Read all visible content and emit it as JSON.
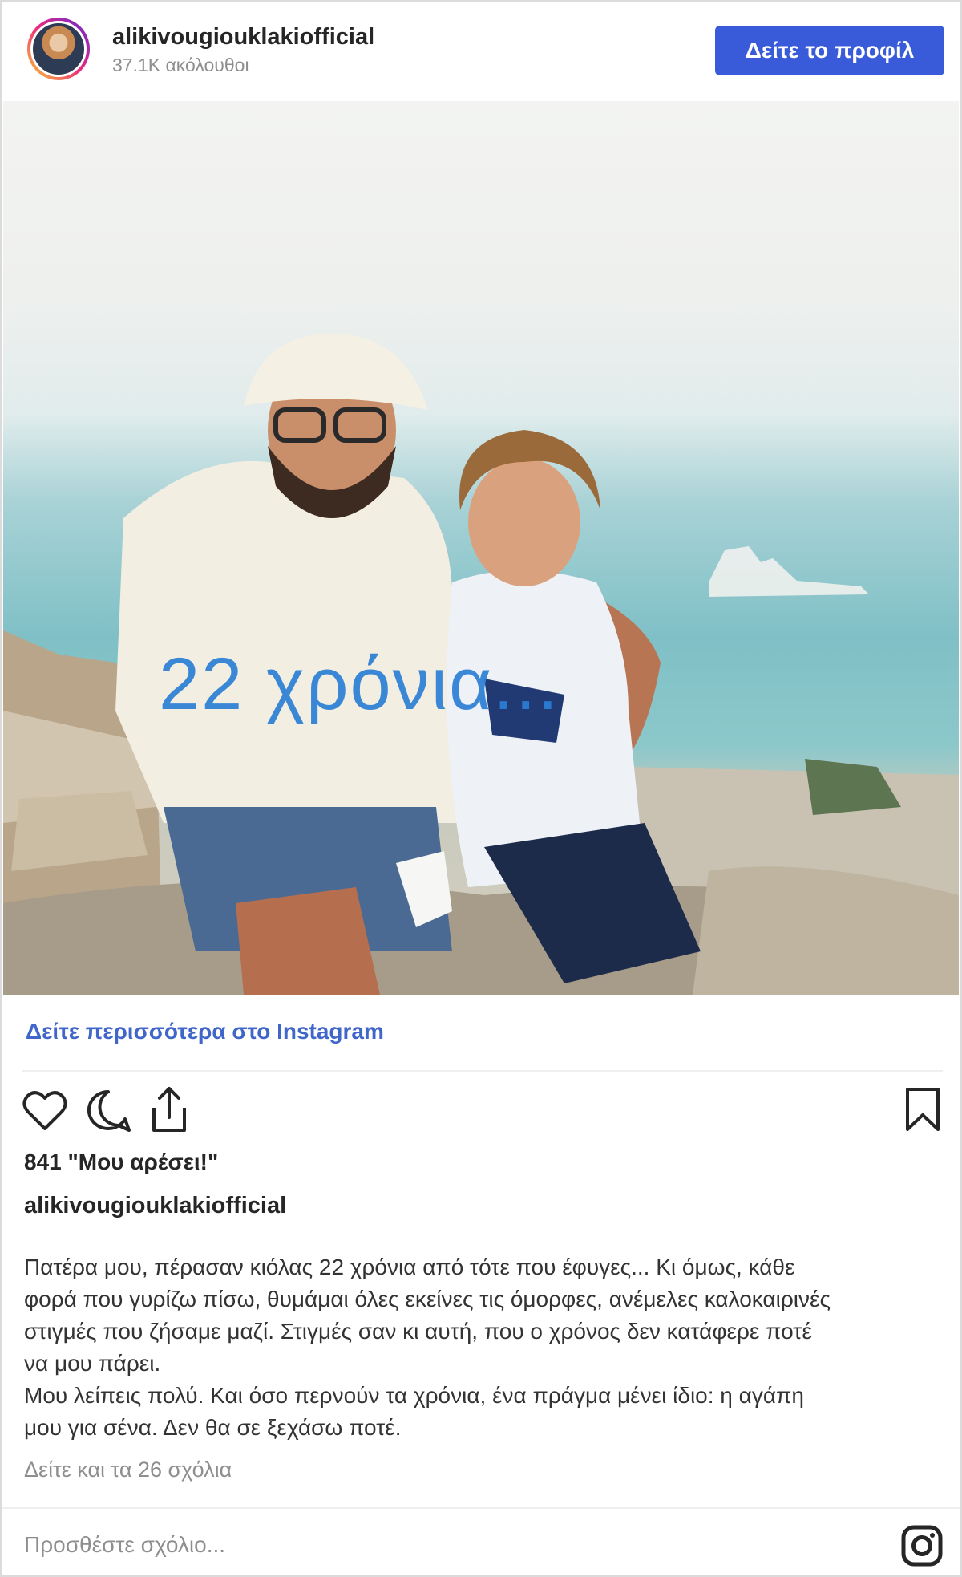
{
  "header": {
    "username": "alikivougiouklakiofficial",
    "followers": "37.1K ακόλουθοι",
    "profile_button": "Δείτε το προφίλ"
  },
  "photo": {
    "overlay_text": "22 χρόνια..."
  },
  "more_link": "Δείτε περισσότερα στο Instagram",
  "actions": {
    "like_icon": "heart-icon",
    "comment_icon": "comment-icon",
    "share_icon": "share-icon",
    "save_icon": "bookmark-icon"
  },
  "likes": "841 \"Μου αρέσει!\"",
  "author": "alikivougiouklakiofficial",
  "caption": "Πατέρα μου, πέρασαν κιόλας 22 χρόνια από τότε που έφυγες... Κι όμως, κάθε\nφορά που γυρίζω πίσω, θυμάμαι όλες εκείνες τις όμορφες, ανέμελες καλοκαιρινές\nστιγμές που ζήσαμε μαζί. Στιγμές σαν κι αυτή, που ο χρόνος δεν κατάφερε ποτέ\nνα μου πάρει.\nΜου λείπεις πολύ. Και όσο περνούν τα χρόνια, ένα πράγμα μένει ίδιο: η αγάπη\nμου για σένα. Δεν θα σε ξεχάσω ποτέ.",
  "comments_link": "Δείτε και τα 26 σχόλια",
  "comment_placeholder": "Προσθέστε σχόλιο...",
  "colors": {
    "button": "#3a5bd9",
    "link": "#3f66c8",
    "overlay_text": "#2b7fd6"
  }
}
